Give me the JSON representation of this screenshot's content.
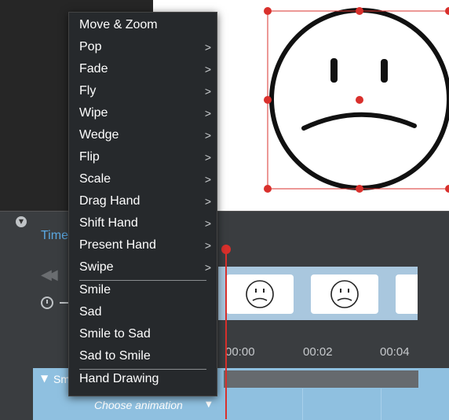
{
  "menu": {
    "items": [
      {
        "label": "Move & Zoom",
        "submenu": false
      },
      {
        "label": "Pop",
        "submenu": true
      },
      {
        "label": "Fade",
        "submenu": true
      },
      {
        "label": "Fly",
        "submenu": true
      },
      {
        "label": "Wipe",
        "submenu": true
      },
      {
        "label": "Wedge",
        "submenu": true
      },
      {
        "label": "Flip",
        "submenu": true
      },
      {
        "label": "Scale",
        "submenu": true
      },
      {
        "label": "Drag Hand",
        "submenu": true
      },
      {
        "label": "Shift Hand",
        "submenu": true
      },
      {
        "label": "Present Hand",
        "submenu": true
      },
      {
        "label": "Swipe",
        "submenu": true
      },
      {
        "label": "Smile",
        "submenu": false
      },
      {
        "label": "Sad",
        "submenu": false
      },
      {
        "label": "Smile to Sad",
        "submenu": false
      },
      {
        "label": "Sad to Smile",
        "submenu": false
      },
      {
        "label": "Hand Drawing",
        "submenu": false
      }
    ],
    "chevron": ">"
  },
  "timeline": {
    "tab_label": "Time",
    "ticks": [
      "00:00",
      "00:02",
      "00:04"
    ],
    "track_label": "Sm",
    "track_arrow": "▼",
    "choose_animation": "Choose animation",
    "choose_arrow": "▼"
  },
  "colors": {
    "accent": "#5aa7e0",
    "selection": "#d9302c",
    "track": "#8fc0e0"
  }
}
